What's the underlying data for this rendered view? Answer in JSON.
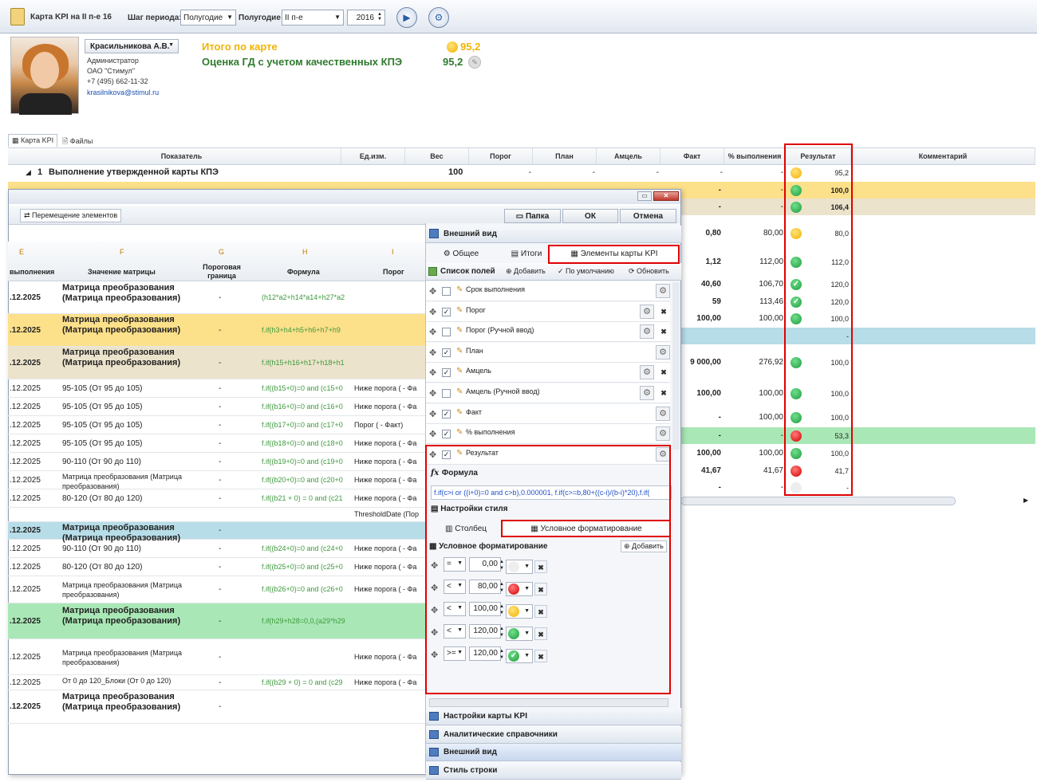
{
  "toolbar": {
    "title": "Карта KPI на II п-е 16",
    "step_label": "Шаг периода:",
    "step_value": "Полугодие",
    "half_label": "Полугодие",
    "half_value": "II п-е",
    "year": "2016"
  },
  "profile": {
    "name": "Красильникова А.В.",
    "role": "Администратор",
    "company": "ОАО \"Стимул\"",
    "phone": "+7 (495) 662-11-32",
    "email": "krasilnikova@stimul.ru"
  },
  "summary": {
    "total_label": "Итого по карте",
    "total_value": "95,2",
    "assessment_label": "Оценка ГД с учетом качественных КПЭ",
    "assessment_value": "95,2"
  },
  "tabs": {
    "kpi_card": "Карта KPI",
    "files": "Файлы"
  },
  "grid": {
    "headers": [
      "Показатель",
      "Ед.изм.",
      "Вес",
      "Порог",
      "План",
      "Амцель",
      "Факт",
      "% выполнения",
      "Результат",
      "Комментарий"
    ],
    "group": {
      "num": "1",
      "name": "Выполнение утвержденной карты КПЭ",
      "weight": "100",
      "porog": "-",
      "plan": "-",
      "amcel": "-",
      "fakt": "-",
      "pct": "-",
      "result": "95,2"
    },
    "rows": [
      {
        "fakt": "-",
        "pct": "-",
        "result": "100,0",
        "dot": "g"
      },
      {
        "fakt": "-",
        "pct": "-",
        "result": "106,4",
        "dot": "g"
      },
      {
        "fakt": "0,80",
        "pct": "80,00",
        "result": "80,0",
        "dot": "y"
      },
      {
        "fakt": "1,12",
        "pct": "112,00",
        "result": "112,0",
        "dot": "g"
      },
      {
        "fakt": "40,60",
        "pct": "106,70",
        "result": "120,0",
        "dot": "c"
      },
      {
        "fakt": "59",
        "pct": "113,46",
        "result": "120,0",
        "dot": "c"
      },
      {
        "fakt": "100,00",
        "pct": "100,00",
        "result": "100,0",
        "dot": "g"
      },
      {
        "fakt": "",
        "pct": "",
        "result": "-",
        "dot": "n"
      },
      {
        "fakt": "9 000,00",
        "pct": "276,92",
        "result": "100,0",
        "dot": "g"
      },
      {
        "fakt": "100,00",
        "pct": "100,00",
        "result": "100,0",
        "dot": "g"
      },
      {
        "fakt": "-",
        "pct": "100,00",
        "result": "100,0",
        "dot": "g"
      },
      {
        "fakt": "-",
        "pct": "-",
        "result": "53,3",
        "dot": "r"
      },
      {
        "fakt": "100,00",
        "pct": "100,00",
        "result": "100,0",
        "dot": "g"
      },
      {
        "fakt": "41,67",
        "pct": "41,67",
        "result": "41,7",
        "dot": "r"
      },
      {
        "fakt": "-",
        "pct": "-",
        "result": "-",
        "dot": "e"
      }
    ]
  },
  "dialog": {
    "move_label": "Перемещение элементов",
    "folder_btn": "Папка",
    "ok_btn": "ОК",
    "cancel_btn": "Отмена",
    "col_letters": [
      "E",
      "F",
      "G",
      "H",
      "I"
    ],
    "col_headers": [
      "выполнения",
      "Значение матрицы",
      "Пороговая граница",
      "Формула",
      "Порог"
    ],
    "rows": [
      {
        "e": ".12.2025",
        "f": "Матрица преобразования (Матрица преобразования)",
        "g": "-",
        "h": "(h12*a2+h14*a14+h27*a2",
        "i": "",
        "bold": true
      },
      {
        "e": ".12.2025",
        "f": "Матрица преобразования (Матрица преобразования)",
        "g": "-",
        "h": "f.if(h3+h4+h5+h6+h7+h9",
        "i": "",
        "bold": true
      },
      {
        "e": ".12.2025",
        "f": "Матрица преобразования (Матрица преобразования)",
        "g": "-",
        "h": "f.if(h15+h16+h17+h18+h1",
        "i": "",
        "bold": true
      },
      {
        "e": ".12.2025",
        "f": "95-105 (От 95 до 105)",
        "g": "-",
        "h": "f.if((b15+0)=0 and (c15+0",
        "i": "Ниже порога ( - Фа"
      },
      {
        "e": ".12.2025",
        "f": "95-105 (От 95 до 105)",
        "g": "-",
        "h": "f.if((b16+0)=0 and (c16+0",
        "i": "Ниже порога ( - Фа"
      },
      {
        "e": ".12.2025",
        "f": "95-105 (От 95 до 105)",
        "g": "-",
        "h": "f.if((b17+0)=0 and (c17+0",
        "i": "Порог ( - Факт)"
      },
      {
        "e": ".12.2025",
        "f": "95-105 (От 95 до 105)",
        "g": "-",
        "h": "f.if((b18+0)=0 and (c18+0",
        "i": "Ниже порога ( - Фа"
      },
      {
        "e": ".12.2025",
        "f": "90-110 (От 90 до 110)",
        "g": "-",
        "h": "f.if((b19+0)=0 and (c19+0",
        "i": "Ниже порога ( - Фа"
      },
      {
        "e": ".12.2025",
        "f": "Матрица преобразования (Матрица преобразования)",
        "g": "-",
        "h": "f.if((b20+0)=0 and (c20+0",
        "i": "Ниже порога ( - Фа"
      },
      {
        "e": ".12.2025",
        "f": "80-120 (От 80 до 120)",
        "g": "-",
        "h": "f.if((b21 + 0) = 0 and (c21",
        "i": "Ниже порога ( - Фа"
      },
      {
        "e": "",
        "f": "",
        "g": "",
        "h": "",
        "i": "ThresholdDate (Пор"
      },
      {
        "e": ".12.2025",
        "f": "Матрица преобразования (Матрица преобразования)",
        "g": "-",
        "h": "",
        "i": "",
        "bold": true
      },
      {
        "e": ".12.2025",
        "f": "90-110 (От 90 до 110)",
        "g": "-",
        "h": "f.if((b24+0)=0 and (c24+0",
        "i": "Ниже порога ( - Фа"
      },
      {
        "e": ".12.2025",
        "f": "80-120 (От 80 до 120)",
        "g": "-",
        "h": "f.if((b25+0)=0 and (c25+0",
        "i": "Ниже порога ( - Фа"
      },
      {
        "e": ".12.2025",
        "f": "Матрица преобразования (Матрица преобразования)",
        "g": "-",
        "h": "f.if((b26+0)=0 and (c26+0",
        "i": "Ниже порога ( - Фа"
      },
      {
        "e": ".12.2025",
        "f": "Матрица преобразования (Матрица преобразования)",
        "g": "-",
        "h": "f.if(h29+h28=0,0,(a29*h29",
        "i": "",
        "bold": true
      },
      {
        "e": ".12.2025",
        "f": "Матрица преобразования (Матрица преобразования)",
        "g": "-",
        "h": "",
        "i": "Ниже порога ( - Фа"
      },
      {
        "e": ".12.2025",
        "f": "От 0 до 120_Блоки (От 0 до 120)",
        "g": "-",
        "h": "f.if((b29 + 0) = 0 and (c29",
        "i": "Ниже порога ( - Фа"
      },
      {
        "e": ".12.2025",
        "f": "Матрица преобразования (Матрица преобразования)",
        "g": "-",
        "h": "",
        "i": "",
        "bold": true
      }
    ]
  },
  "panel": {
    "view_title": "Внешний вид",
    "tabs": [
      "Общее",
      "Итоги",
      "Элементы карты KPI"
    ],
    "fields_title": "Список полей",
    "add": "Добавить",
    "default": "По умолчанию",
    "refresh": "Обновить",
    "fields": [
      {
        "name": "Срок выполнения",
        "checked": false
      },
      {
        "name": "Порог",
        "checked": true
      },
      {
        "name": "Порог (Ручной ввод)",
        "checked": false
      },
      {
        "name": "План",
        "checked": true
      },
      {
        "name": "Амцель",
        "checked": true
      },
      {
        "name": "Амцель (Ручной ввод)",
        "checked": false
      },
      {
        "name": "Факт",
        "checked": true
      },
      {
        "name": "% выполнения",
        "checked": true
      },
      {
        "name": "Результат",
        "checked": true
      }
    ],
    "formula_title": "Формула",
    "formula": "f.if(c>i or ((i+0)=0 and c>b),0.000001, f.if(c>=b,80+((c-i)/(b-i)*20),f.if(",
    "style_title": "Настройки стиля",
    "style_tabs": [
      "Столбец",
      "Условное форматирование"
    ],
    "cf_title": "Условное форматирование",
    "cf_add": "Добавить",
    "cf_rules": [
      {
        "op": "=",
        "value": "0,00",
        "color": "none"
      },
      {
        "op": "<",
        "value": "80,00",
        "color": "red"
      },
      {
        "op": "<",
        "value": "100,00",
        "color": "yellow"
      },
      {
        "op": "<",
        "value": "120,00",
        "color": "green"
      },
      {
        "op": ">=",
        "value": "120,00",
        "color": "check"
      }
    ],
    "bottom": [
      "Настройки карты KPI",
      "Аналитические справочники",
      "Внешний вид",
      "Стиль строки"
    ]
  },
  "colors": {
    "accent": "#e00000",
    "yellow_row": "#fde08a",
    "beige_row": "#ece3cc",
    "blue_row": "#b7dde8",
    "green_row": "#a9e8b6"
  }
}
